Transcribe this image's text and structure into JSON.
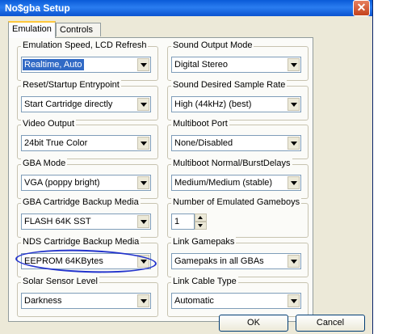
{
  "window": {
    "title": "No$gba Setup",
    "close_symbol": "✕"
  },
  "tabs": [
    {
      "label": "Emulation",
      "active": true
    },
    {
      "label": "Controls",
      "active": false
    }
  ],
  "left_groups": [
    {
      "label": "Emulation Speed, LCD Refresh",
      "value": "Realtime, Auto",
      "selected": true
    },
    {
      "label": "Reset/Startup Entrypoint",
      "value": "Start Cartridge directly"
    },
    {
      "label": "Video Output",
      "value": "24bit True Color"
    },
    {
      "label": "GBA Mode",
      "value": "VGA (poppy bright)"
    },
    {
      "label": "GBA Cartridge Backup Media",
      "value": "FLASH 64K SST"
    },
    {
      "label": "NDS Cartridge Backup Media",
      "value": "EEPROM 64KBytes",
      "circled": true
    },
    {
      "label": "Solar Sensor Level",
      "value": "Darkness"
    }
  ],
  "right_groups": [
    {
      "label": "Sound Output Mode",
      "value": "Digital Stereo"
    },
    {
      "label": "Sound Desired Sample Rate",
      "value": "High (44kHz) (best)"
    },
    {
      "label": "Multiboot Port",
      "value": "None/Disabled"
    },
    {
      "label": "Multiboot Normal/BurstDelays",
      "value": "Medium/Medium (stable)"
    },
    {
      "label": "Number of Emulated Gameboys",
      "value": "1",
      "spinner": true
    },
    {
      "label": "Link Gamepaks",
      "value": "Gamepaks in all GBAs"
    },
    {
      "label": "Link Cable Type",
      "value": "Automatic"
    }
  ],
  "buttons": {
    "ok": "OK",
    "cancel": "Cancel"
  },
  "colors": {
    "title_bar": "#0a5ad8",
    "selection": "#316ac5",
    "annotation": "#2233cc"
  }
}
